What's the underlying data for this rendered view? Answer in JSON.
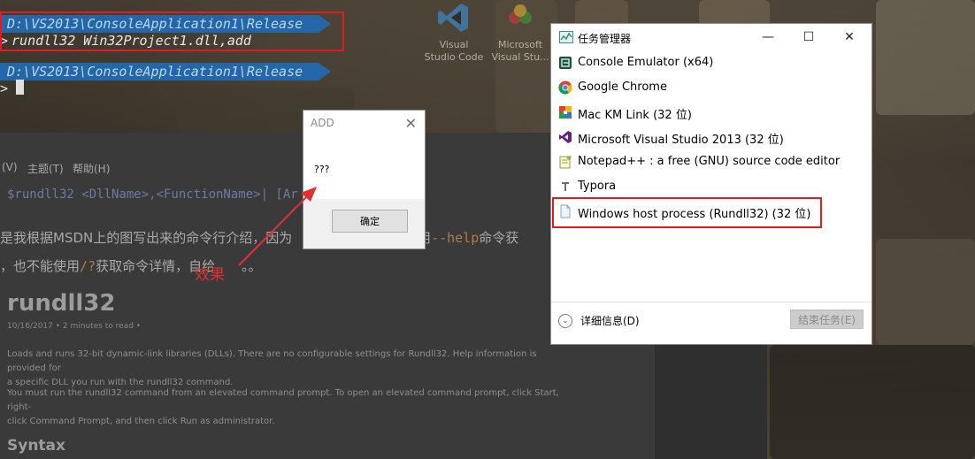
{
  "console": {
    "path1": "D:\\VS2013\\ConsoleApplication1\\Release",
    "cmd1_chevron": ">",
    "cmd1": "rundll32 Win32Project1.dll,add",
    "path2": "D:\\VS2013\\ConsoleApplication1\\Release",
    "cmd2_chevron": ">"
  },
  "desktop_icons": [
    {
      "label_line1": "Visual",
      "label_line2": "Studio Code"
    },
    {
      "label_line1": "Microsoft",
      "label_line2": "Visual Stu..."
    }
  ],
  "doc": {
    "menu_view": "(V)",
    "menu_theme": "主题(T)",
    "menu_help": "帮助(H)",
    "code_line": "$rundll32 <DllName>,<FunctionName>| [Ar",
    "cn_line1_a": "是我根据MSDN上的图写出来的命令行介绍，因为",
    "cn_line1_b": "使用",
    "cn_line1_code": "--help",
    "cn_line1_c": "命令获",
    "cn_line2_a": "，也不能使用",
    "cn_line2_code": "/?",
    "cn_line2_b": "获取命令详情，自给",
    "cn_line2_dots": "。。",
    "h1": "rundll32",
    "meta": "10/16/2017 • 2 minutes to read •",
    "p1_line1": "Loads and runs 32-bit dynamic-link libraries (DLLs). There are no configurable settings for Rundll32. Help information is provided for",
    "p1_line2": "a specific DLL you run with the rundll32 command.",
    "p2_line1": "You must run the rundll32 command from an elevated command prompt. To open an elevated command prompt, click Start, right-",
    "p2_line2": "click Command Prompt, and then click Run as administrator.",
    "h2": "Syntax"
  },
  "msgbox": {
    "title": "ADD",
    "close": "✕",
    "message": "???",
    "ok_label": "确定"
  },
  "annotation": {
    "text": "效果",
    "color": "#e03030"
  },
  "taskmgr": {
    "title": "任务管理器",
    "minimize": "—",
    "maximize": "☐",
    "close": "✕",
    "processes": [
      {
        "label": "Console Emulator (x64)",
        "icon": "console-emulator-icon"
      },
      {
        "label": "Google Chrome",
        "icon": "chrome-icon"
      },
      {
        "label": "Mac KM Link (32 位)",
        "icon": "mac-km-link-icon"
      },
      {
        "label": "Microsoft Visual Studio 2013 (32 位)",
        "icon": "visual-studio-icon"
      },
      {
        "label": "Notepad++ : a free (GNU) source code editor",
        "icon": "notepadpp-icon"
      },
      {
        "label": "Typora",
        "icon": "typora-icon"
      },
      {
        "label": "Windows host process (Rundll32) (32 位)",
        "icon": "document-icon"
      }
    ],
    "details_label": "详细信息(D)",
    "end_task_label": "结束任务(E)"
  },
  "colors": {
    "highlight_red": "#e01b24",
    "prompt_blue": "#2467a8"
  }
}
